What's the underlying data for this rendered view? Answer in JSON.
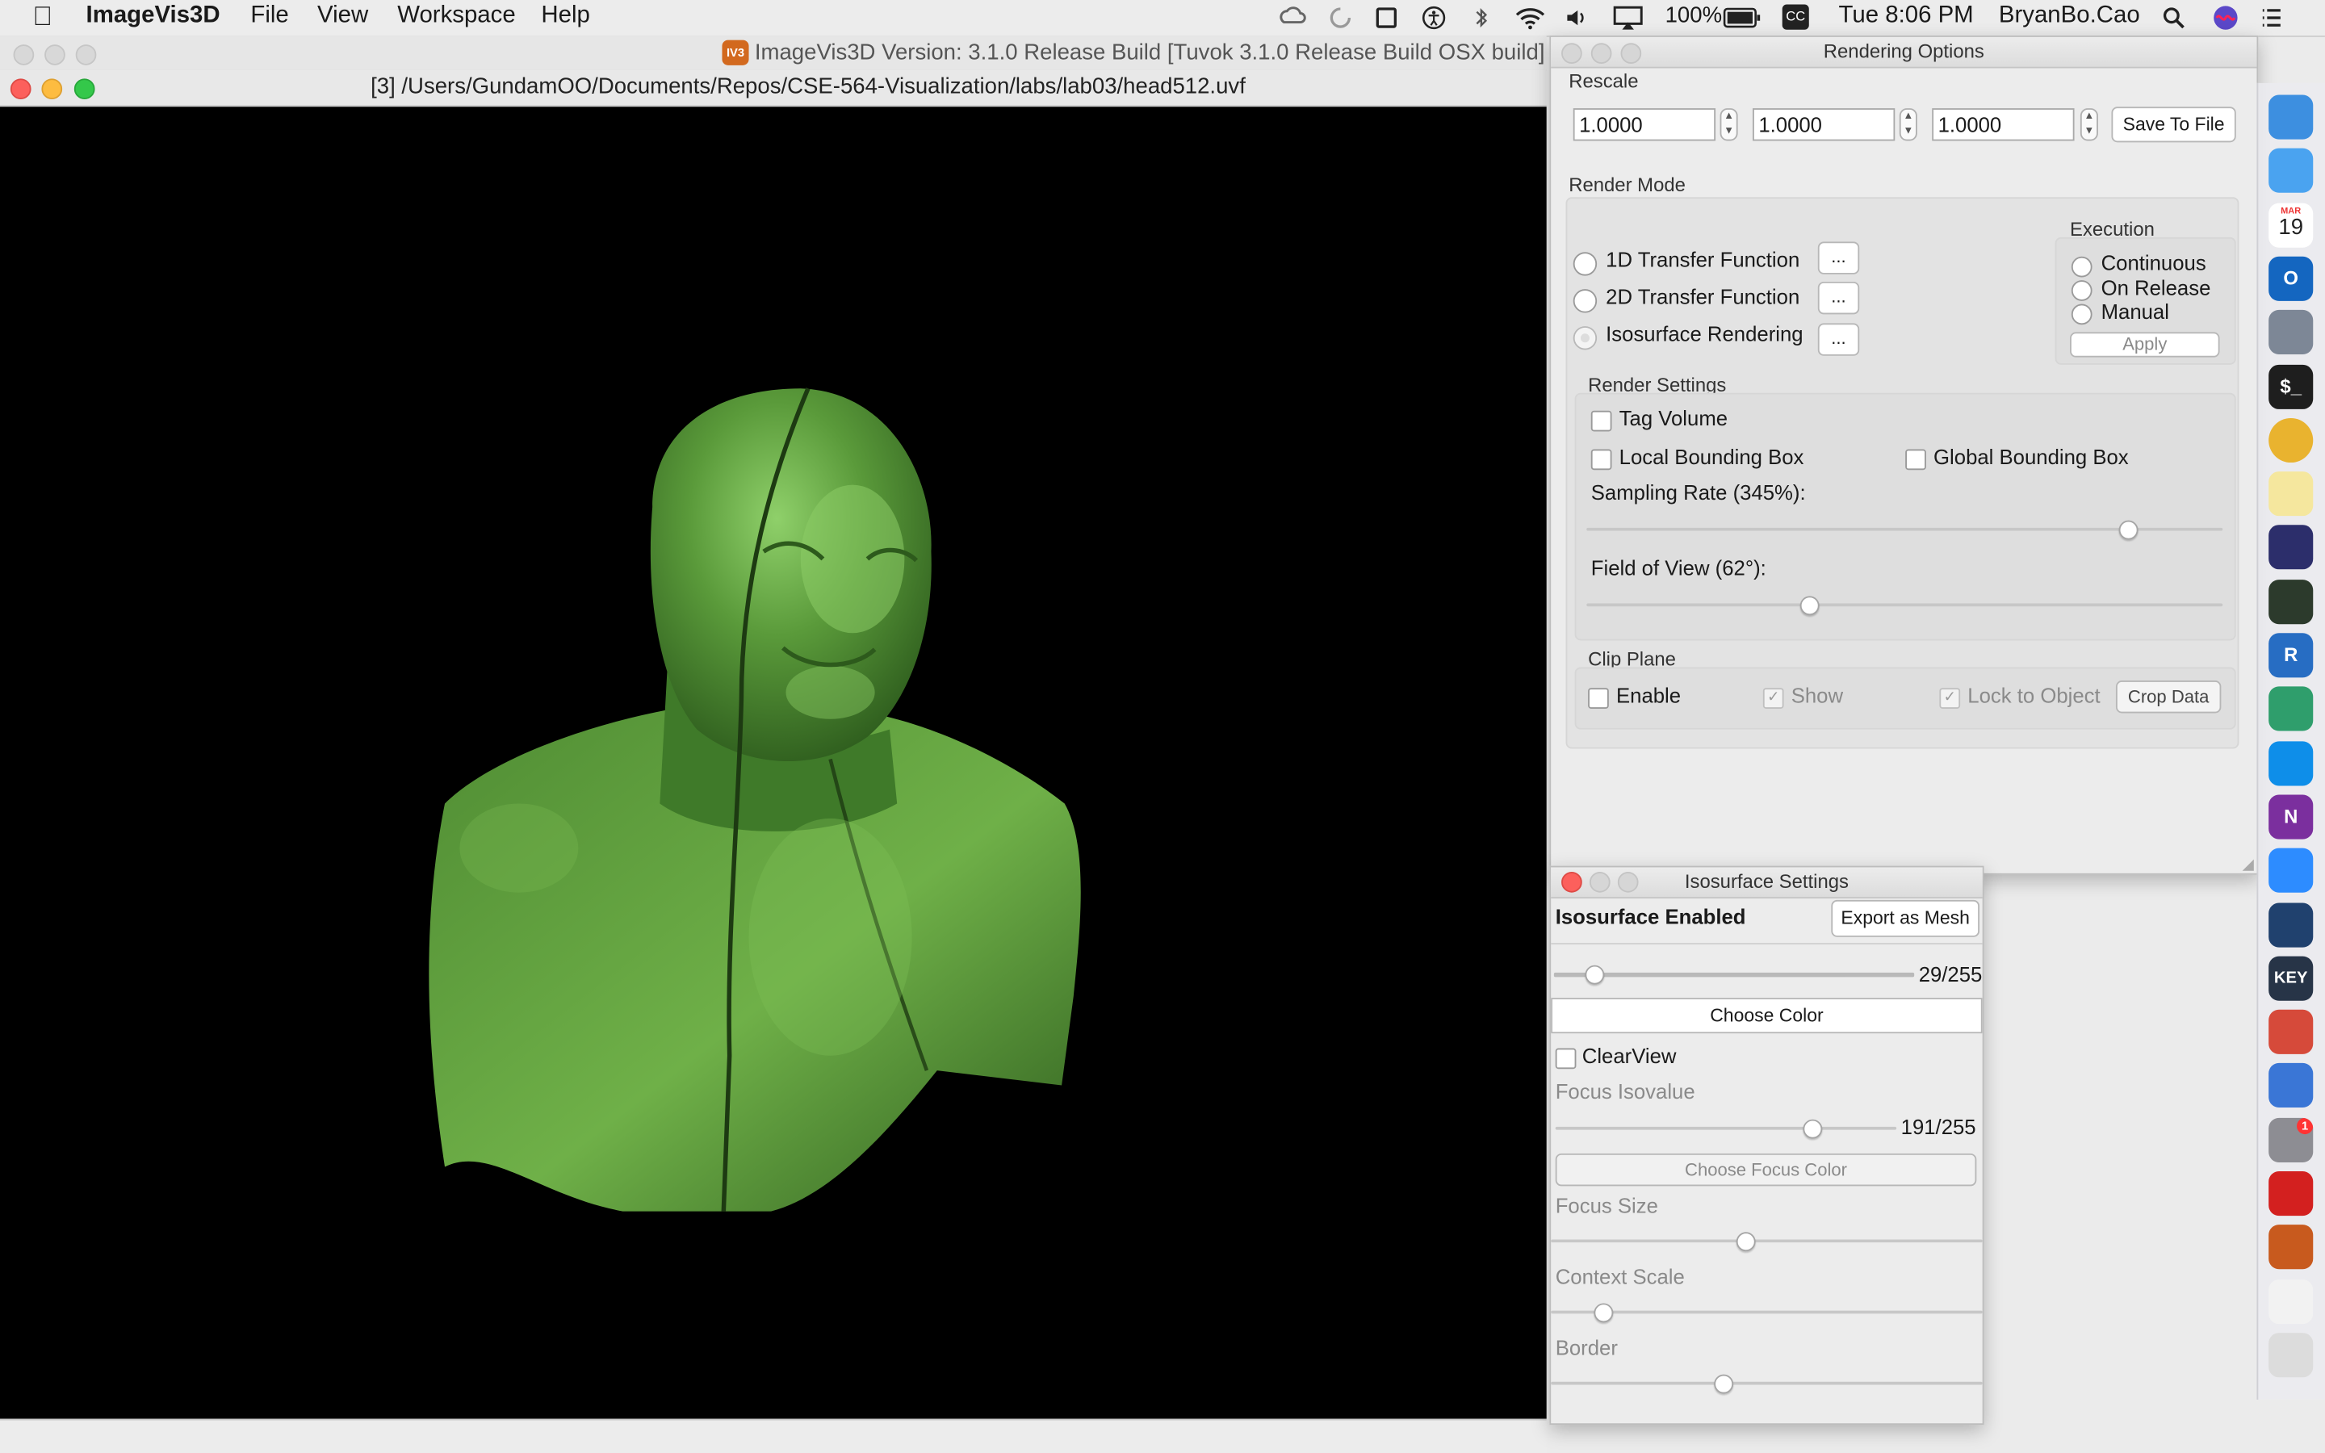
{
  "menubar": {
    "app_name": "ImageVis3D",
    "items": [
      "File",
      "View",
      "Workspace",
      "Help"
    ],
    "battery": "100%",
    "cc_badge": "CC",
    "clock": "Tue 8:06 PM",
    "user": "BryanBo.Cao"
  },
  "main_window": {
    "title_badge": "IV3",
    "title": "ImageVis3D Version: 3.1.0 Release Build [Tuvok 3.1.0 Release Build OSX build]",
    "doc_title": "[3] /Users/GundamOO/Documents/Repos/CSE-564-Visualization/labs/lab03/head512.uvf",
    "render_color": "#5a9a3a"
  },
  "rendering_options": {
    "title": "Rendering Options",
    "rescale": {
      "label": "Rescale",
      "values": [
        "1.0000",
        "1.0000",
        "1.0000"
      ],
      "save_label": "Save To File"
    },
    "render_mode": {
      "label": "Render Mode",
      "options": [
        "1D Transfer Function",
        "2D Transfer Function",
        "Isosurface Rendering"
      ],
      "more_label": "...",
      "selected": "Isosurface Rendering"
    },
    "execution": {
      "label": "Execution",
      "options": [
        "Continuous",
        "On Release",
        "Manual"
      ],
      "apply_label": "Apply"
    },
    "render_settings": {
      "label": "Render Settings",
      "tag_volume": "Tag Volume",
      "local_bbox": "Local Bounding Box",
      "global_bbox": "Global Bounding Box",
      "sampling_label": "Sampling Rate (345%):",
      "sampling_level": 0.85,
      "fov_label": "Field of View (62°):",
      "fov_level": 0.35
    },
    "clip_plane": {
      "label": "Clip Plane",
      "enable": "Enable",
      "show": "Show",
      "lock": "Lock to Object",
      "crop_label": "Crop Data"
    }
  },
  "isosurface_settings": {
    "title": "Isosurface Settings",
    "enabled_label": "Isosurface Enabled",
    "export_label": "Export as Mesh",
    "iso_value": "29/255",
    "iso_level": 0.11,
    "choose_color": "Choose Color",
    "clearview": "ClearView",
    "focus_isovalue_label": "Focus Isovalue",
    "focus_value": "191/255",
    "focus_level": 0.75,
    "choose_focus_color": "Choose Focus Color",
    "focus_size_label": "Focus Size",
    "focus_size_level": 0.45,
    "context_scale_label": "Context Scale",
    "context_scale_level": 0.12,
    "border_label": "Border",
    "border_level": 0.4
  },
  "dock": {
    "items": [
      {
        "name": "finder",
        "color": "#3d8fe0"
      },
      {
        "name": "pencil-app",
        "color": "#4aa3f0"
      },
      {
        "name": "calendar",
        "color": "#ffffff",
        "month": "MAR",
        "day": "19"
      },
      {
        "name": "outlook",
        "color": "#1466c0",
        "glyph": "O"
      },
      {
        "name": "rocket",
        "color": "#7d8796"
      },
      {
        "name": "terminal",
        "color": "#1e1e1e",
        "glyph": "$_"
      },
      {
        "name": "chrome",
        "color": "#e9b32f"
      },
      {
        "name": "notes",
        "color": "#f5e79e"
      },
      {
        "name": "eclipse",
        "color": "#2c2e6b"
      },
      {
        "name": "activity-monitor",
        "color": "#2c3a2c"
      },
      {
        "name": "r-app",
        "color": "#276dc3",
        "glyph": "R"
      },
      {
        "name": "photos-app",
        "color": "#2f9e6c"
      },
      {
        "name": "teamviewer",
        "color": "#0e8ee9"
      },
      {
        "name": "onenote",
        "color": "#7b2f9e",
        "glyph": "N"
      },
      {
        "name": "zoom",
        "color": "#2d8cff"
      },
      {
        "name": "quicktime",
        "color": "#20416e"
      },
      {
        "name": "keynote",
        "color": "#273447",
        "glyph": "KEY"
      },
      {
        "name": "disk-app",
        "color": "#d64a3a"
      },
      {
        "name": "color-app",
        "color": "#3a76d6"
      },
      {
        "name": "system-preferences",
        "color": "#8d8d93",
        "badge": "1"
      },
      {
        "name": "acrobat",
        "color": "#d3201f"
      },
      {
        "name": "imagevis3d",
        "color": "#c85a1e"
      },
      {
        "name": "document-stack",
        "color": "#f2f2f2"
      },
      {
        "name": "trash",
        "color": "#dcdcdc"
      }
    ]
  }
}
